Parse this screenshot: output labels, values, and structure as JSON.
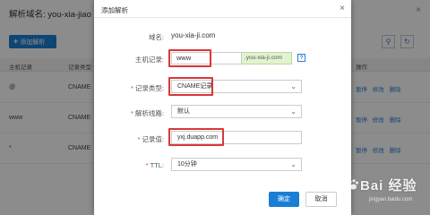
{
  "background": {
    "title": "解析域名: you-xia-jiao",
    "close_glyph": "×",
    "add_button": "添加解析",
    "search_icon": "search-icon",
    "refresh_icon": "refresh-icon",
    "columns": [
      "主机记录",
      "记录类型",
      "操作"
    ],
    "rows": [
      {
        "host": "@",
        "type": "CNAME",
        "ops": "暂停 修改 删除"
      },
      {
        "host": "www",
        "type": "CNAME",
        "ops": "暂停 修改 删除"
      },
      {
        "host": "*",
        "type": "CNAME",
        "ops": "暂停 修改 删除"
      }
    ]
  },
  "dialog": {
    "title": "添加解析",
    "close_glyph": "×",
    "domain_label": "域名:",
    "domain_value": "you-xia-ji.com",
    "host_label": "主机记录:",
    "host_value": "www",
    "host_suffix": ".you-xia-ji.com",
    "help_icon": "help-icon",
    "help_glyph": "?",
    "type_label": "记录类型:",
    "type_value": "CNAME记录",
    "line_label": "解析线路:",
    "line_value": "默认",
    "value_label": "记录值:",
    "value_value": "yxj.duapp.com",
    "ttl_label": "TTL:",
    "ttl_value": "10分钟",
    "chevron_glyph": "⌄",
    "ok_button": "确定",
    "cancel_button": "取消"
  },
  "watermark": {
    "text": "Bai 经验",
    "url": "jingyan.baidu.com"
  },
  "colors": {
    "accent": "#1a7ed6",
    "highlight": "#d93838",
    "suffix_bg": "#e2f3d0"
  }
}
